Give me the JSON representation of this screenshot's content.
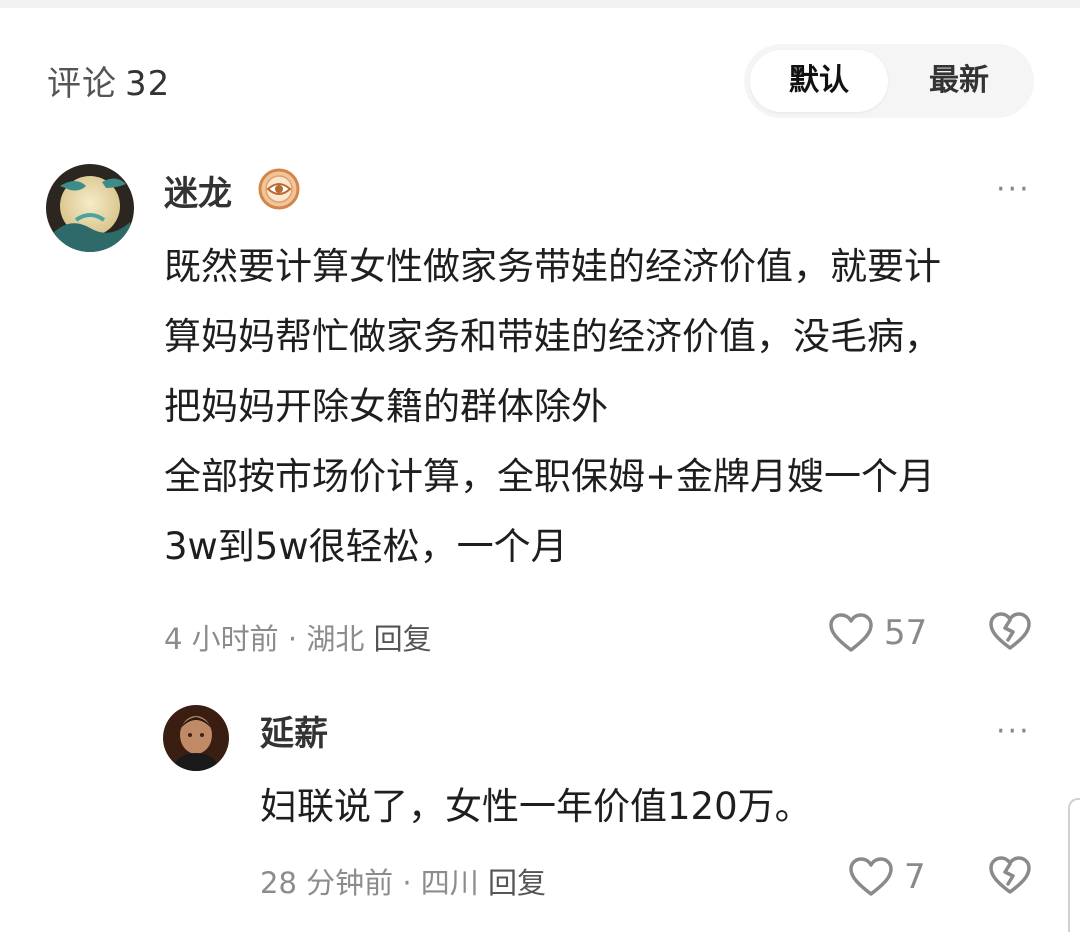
{
  "header": {
    "comments_label": "评论",
    "comments_count": "32",
    "sort_options": [
      "默认",
      "最新"
    ],
    "sort_selected": "默认"
  },
  "comments": [
    {
      "username": "迷龙",
      "badge_icon": "eye-badge-icon",
      "text_lines": [
        "既然要计算女性做家务带娃的经济价值，就要计",
        "算妈妈帮忙做家务和带娃的经济价值，没毛病，",
        "把妈妈开除女籍的群体除外",
        "全部按市场价计算，全职保姆+金牌月嫂一个月",
        "3w到5w很轻松，一个月"
      ],
      "time": "4 小时前",
      "location": "湖北",
      "reply_label": "回复",
      "likes": "57"
    },
    {
      "username": "延薪",
      "text_lines": [
        "妇联说了，女性一年价值120万。"
      ],
      "time": "28 分钟前",
      "location": "四川",
      "reply_label": "回复",
      "likes": "7"
    }
  ],
  "more_label": "···",
  "colors": {
    "badge": "#d4864a",
    "toggle_bg": "#f5f5f5",
    "meta_text": "#8c8c8c"
  }
}
